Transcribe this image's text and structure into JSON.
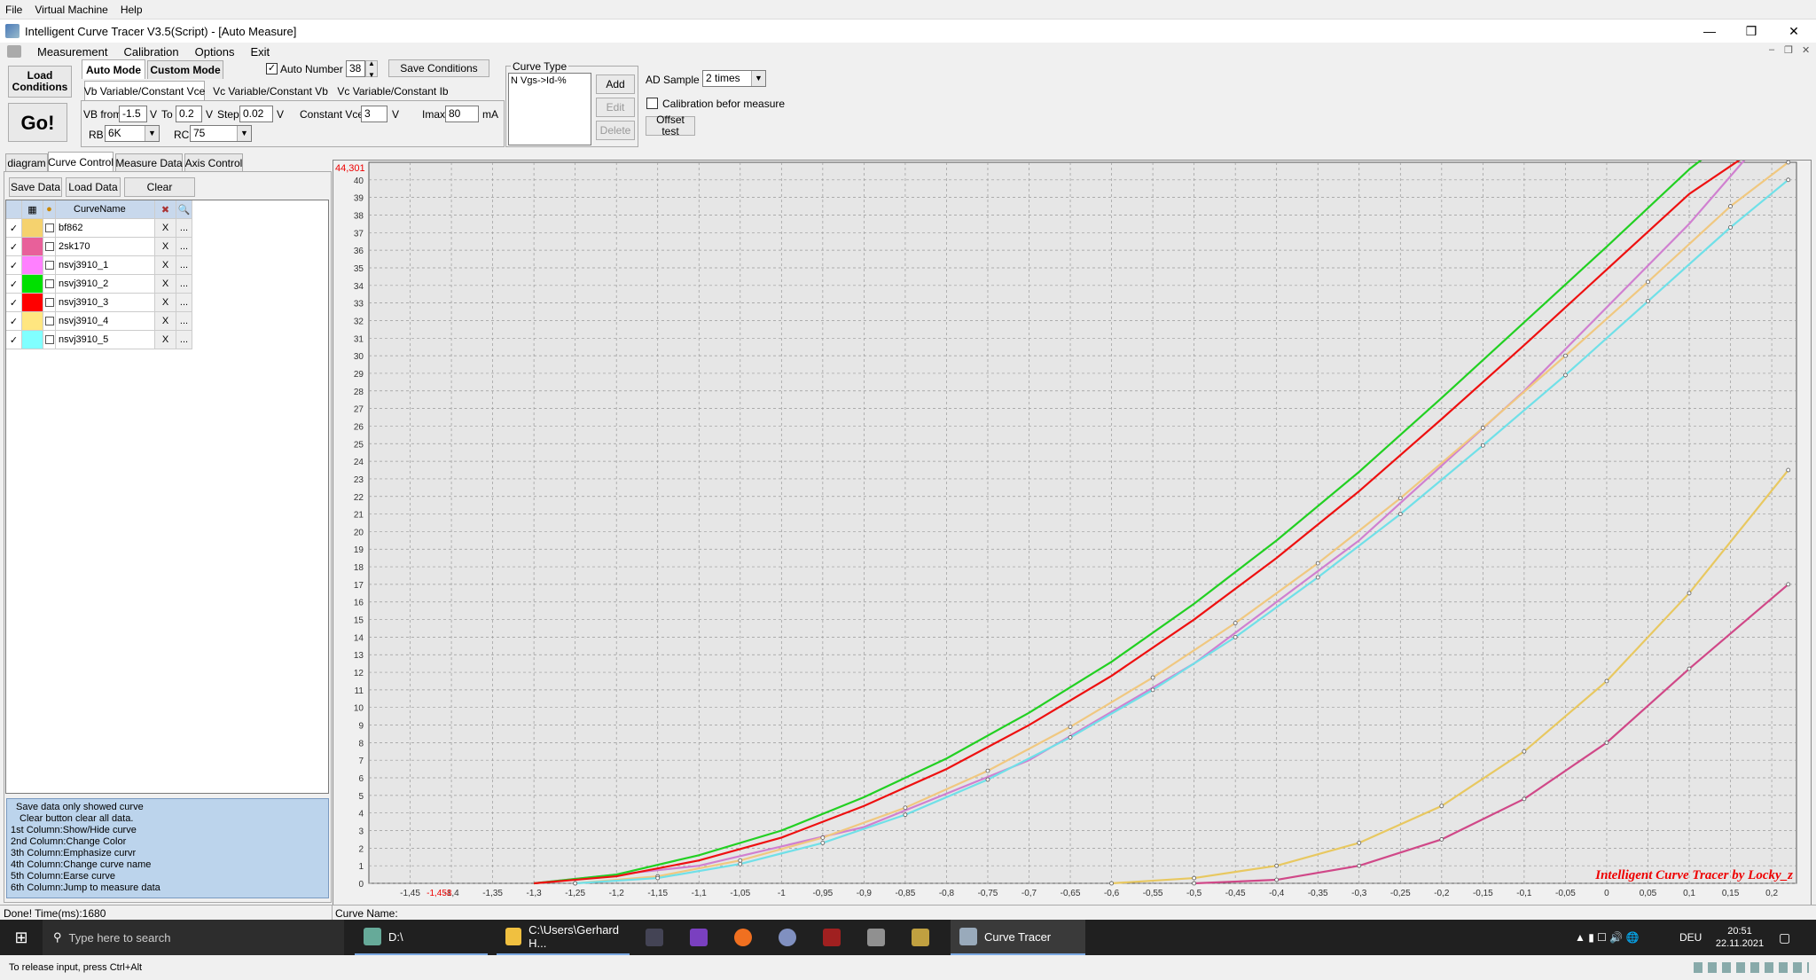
{
  "host_menu": [
    "File",
    "Virtual Machine",
    "Help"
  ],
  "window": {
    "title": "Intelligent Curve Tracer V3.5(Script) - [Auto Measure]",
    "minimize": "—",
    "maximize": "❒",
    "close": "✕"
  },
  "app_menu": [
    "Measurement",
    "Calibration",
    "Options",
    "Exit"
  ],
  "toolbar": {
    "load_conditions": "Load Conditions",
    "go": "Go!",
    "auto_mode": "Auto Mode",
    "custom_mode": "Custom Mode",
    "auto_number_label": "Auto Number",
    "auto_number_checked": true,
    "auto_number_value": "38",
    "save_conditions": "Save Conditions",
    "mode_tabs": [
      "Vb Variable/Constant Vce",
      "Vc Variable/Constant Vb",
      "Vc Variable/Constant Ib"
    ],
    "vb_from_label": "VB from",
    "vb_from": "-1.5",
    "v1": "V",
    "to_label": "To",
    "to": "0.2",
    "v2": "V",
    "step_label": "Step",
    "step": "0.02",
    "v3": "V",
    "constant_vce_label": "Constant Vce",
    "constant_vce": "3",
    "v4": "V",
    "imax_label": "Imax",
    "imax": "80",
    "ma": "mA",
    "rb_label": "RB",
    "rb": "6K",
    "rc_label": "RC",
    "rc": "75",
    "curve_type_label": "Curve Type",
    "curve_type_item": "N Vgs->Id-%",
    "add": "Add",
    "edit": "Edit",
    "delete": "Delete",
    "ad_sample_label": "AD Sample",
    "ad_sample": "2 times",
    "calibration_label": "Calibration befor measure",
    "calibration_checked": false,
    "offset_test": "Offset test"
  },
  "left_tabs": [
    "diagram",
    "Curve Control",
    "Measure Data",
    "Axis Control"
  ],
  "left_buttons": {
    "save": "Save Data",
    "load": "Load Data",
    "clear": "Clear"
  },
  "grid_header": {
    "name": "CurveName"
  },
  "curves": [
    {
      "name": "bf862",
      "color": "#f5d26e",
      "shown": true
    },
    {
      "name": "2sk170",
      "color": "#e8609a",
      "shown": true
    },
    {
      "name": "nsvj3910_1",
      "color": "#ff80ff",
      "shown": true
    },
    {
      "name": "nsvj3910_2",
      "color": "#00e000",
      "shown": true
    },
    {
      "name": "nsvj3910_3",
      "color": "#ff0000",
      "shown": true
    },
    {
      "name": "nsvj3910_4",
      "color": "#ffe680",
      "shown": true
    },
    {
      "name": "nsvj3910_5",
      "color": "#80ffff",
      "shown": true
    }
  ],
  "row_del": "X",
  "row_more": "...",
  "info_lines": [
    "Save data only showed curve",
    "Clear button clear all data.",
    "1st Column:Show/Hide curve",
    "2nd Column:Change Color",
    "3th Column:Emphasize curvr",
    "4th Column:Change curve name",
    "5th Column:Earse curve",
    "6th Column:Jump to measure data"
  ],
  "chart": {
    "max_label": "44,301",
    "cursor_label": "-1,458",
    "watermark": "Intelligent Curve Tracer by Locky_z"
  },
  "chart_data": {
    "type": "line",
    "title": "",
    "xlabel": "",
    "ylabel": "",
    "xlim": [
      -1.5,
      0.23
    ],
    "ylim": [
      0,
      41
    ],
    "grid": true,
    "x_ticks": [
      "-1,45",
      "-1,4",
      "-1,35",
      "-1,3",
      "-1,25",
      "-1,2",
      "-1,15",
      "-1,1",
      "-1,05",
      "-1",
      "-0,95",
      "-0,9",
      "-0,85",
      "-0,8",
      "-0,75",
      "-0,7",
      "-0,65",
      "-0,6",
      "-0,55",
      "-0,5",
      "-0,45",
      "-0,4",
      "-0,35",
      "-0,3",
      "-0,25",
      "-0,2",
      "-0,15",
      "-0,1",
      "-0,05",
      "0",
      "0,05",
      "0,1",
      "0,15",
      "0,2"
    ],
    "x_tick_values": [
      -1.45,
      -1.4,
      -1.35,
      -1.3,
      -1.25,
      -1.2,
      -1.15,
      -1.1,
      -1.05,
      -1,
      -0.95,
      -0.9,
      -0.85,
      -0.8,
      -0.75,
      -0.7,
      -0.65,
      -0.6,
      -0.55,
      -0.5,
      -0.45,
      -0.4,
      -0.35,
      -0.3,
      -0.25,
      -0.2,
      -0.15,
      -0.1,
      -0.05,
      0,
      0.05,
      0.1,
      0.15,
      0.2
    ],
    "y_ticks": [
      0,
      1,
      2,
      3,
      4,
      5,
      6,
      7,
      8,
      9,
      10,
      11,
      12,
      13,
      14,
      15,
      16,
      17,
      18,
      19,
      20,
      21,
      22,
      23,
      24,
      25,
      26,
      27,
      28,
      29,
      30,
      31,
      32,
      33,
      34,
      35,
      36,
      37,
      38,
      39,
      40
    ],
    "series": [
      {
        "name": "bf862",
        "color": "#e8c860",
        "markers": true,
        "x": [
          -0.6,
          -0.5,
          -0.4,
          -0.3,
          -0.2,
          -0.1,
          0,
          0.1,
          0.22
        ],
        "y": [
          0,
          0.3,
          1,
          2.3,
          4.4,
          7.5,
          11.5,
          16.5,
          23.5
        ]
      },
      {
        "name": "2sk170",
        "color": "#d04888",
        "markers": true,
        "x": [
          -0.5,
          -0.4,
          -0.3,
          -0.2,
          -0.1,
          0,
          0.1,
          0.22
        ],
        "y": [
          0,
          0.2,
          1,
          2.5,
          4.8,
          8,
          12.2,
          17
        ]
      },
      {
        "name": "nsvj3910_1",
        "color": "#d080d0",
        "markers": false,
        "x": [
          -1.3,
          -1.1,
          -0.9,
          -0.7,
          -0.5,
          -0.3,
          -0.1,
          0.1,
          0.22
        ],
        "y": [
          0,
          1,
          3.2,
          7,
          12.5,
          19.5,
          28,
          37.5,
          44
        ]
      },
      {
        "name": "nsvj3910_2",
        "color": "#22d022",
        "markers": false,
        "x": [
          -1.3,
          -1.2,
          -1.1,
          -1,
          -0.9,
          -0.8,
          -0.7,
          -0.6,
          -0.5,
          -0.4,
          -0.3,
          -0.2,
          -0.1,
          0,
          0.1,
          0.22
        ],
        "y": [
          0,
          0.5,
          1.6,
          3,
          4.9,
          7.1,
          9.7,
          12.6,
          15.9,
          19.5,
          23.4,
          27.6,
          31.9,
          36.2,
          40.6,
          45
        ]
      },
      {
        "name": "nsvj3910_3",
        "color": "#ee1010",
        "markers": false,
        "x": [
          -1.3,
          -1.2,
          -1.1,
          -1,
          -0.9,
          -0.8,
          -0.7,
          -0.6,
          -0.5,
          -0.4,
          -0.3,
          -0.2,
          -0.1,
          0,
          0.1,
          0.22
        ],
        "y": [
          0,
          0.4,
          1.3,
          2.6,
          4.4,
          6.5,
          9,
          11.8,
          15,
          18.5,
          22.3,
          26.4,
          30.6,
          34.9,
          39.2,
          43
        ]
      },
      {
        "name": "nsvj3910_4",
        "color": "#f0c880",
        "markers": true,
        "x": [
          -1.25,
          -1.15,
          -1.05,
          -0.95,
          -0.85,
          -0.75,
          -0.65,
          -0.55,
          -0.45,
          -0.35,
          -0.25,
          -0.15,
          -0.05,
          0.05,
          0.15,
          0.22
        ],
        "y": [
          0,
          0.4,
          1.3,
          2.6,
          4.3,
          6.4,
          8.9,
          11.7,
          14.8,
          18.2,
          21.9,
          25.9,
          30,
          34.2,
          38.5,
          41
        ]
      },
      {
        "name": "nsvj3910_5",
        "color": "#70e0e8",
        "markers": true,
        "x": [
          -1.25,
          -1.15,
          -1.05,
          -0.95,
          -0.85,
          -0.75,
          -0.65,
          -0.55,
          -0.45,
          -0.35,
          -0.25,
          -0.15,
          -0.05,
          0.05,
          0.15,
          0.22
        ],
        "y": [
          0,
          0.3,
          1.1,
          2.3,
          3.9,
          5.9,
          8.3,
          11,
          14,
          17.4,
          21,
          24.9,
          28.9,
          33.1,
          37.3,
          40
        ]
      }
    ]
  },
  "status": {
    "left": "Done!  Time(ms):1680",
    "right": "Curve Name:"
  },
  "taskbar": {
    "search": "Type here to search",
    "item1": "D:\\",
    "item2": "C:\\Users\\Gerhard H...",
    "item3": "Curve Tracer",
    "lang": "DEU",
    "time": "20:51",
    "date": "22.11.2021"
  },
  "vm_hint": "To release input, press Ctrl+Alt"
}
